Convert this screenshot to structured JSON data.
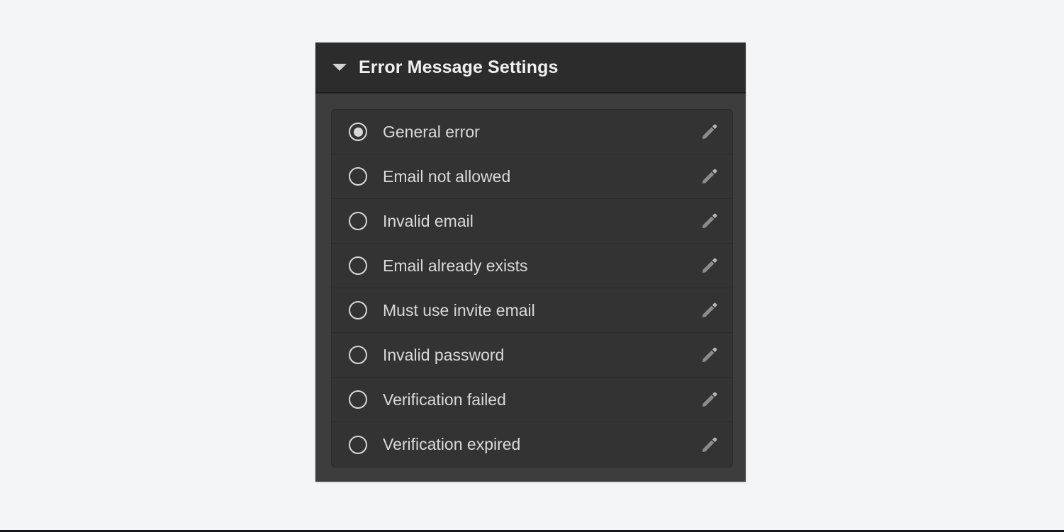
{
  "page": {
    "background_color": "#f4f5f7"
  },
  "panel": {
    "title": "Error Message Settings",
    "collapse_icon": "triangle-down-icon",
    "expanded": true,
    "header_color": "#2c2c2c",
    "body_color": "#3d3d3d",
    "row_color": "#333333",
    "text_color": "#d9d9d9",
    "rows": [
      {
        "label": "General error",
        "selected": true,
        "edit_icon": "pencil-icon"
      },
      {
        "label": "Email not allowed",
        "selected": false,
        "edit_icon": "pencil-icon"
      },
      {
        "label": "Invalid email",
        "selected": false,
        "edit_icon": "pencil-icon"
      },
      {
        "label": "Email already exists",
        "selected": false,
        "edit_icon": "pencil-icon"
      },
      {
        "label": "Must use invite email",
        "selected": false,
        "edit_icon": "pencil-icon"
      },
      {
        "label": "Invalid password",
        "selected": false,
        "edit_icon": "pencil-icon"
      },
      {
        "label": "Verification failed",
        "selected": false,
        "edit_icon": "pencil-icon"
      },
      {
        "label": "Verification expired",
        "selected": false,
        "edit_icon": "pencil-icon"
      }
    ]
  }
}
